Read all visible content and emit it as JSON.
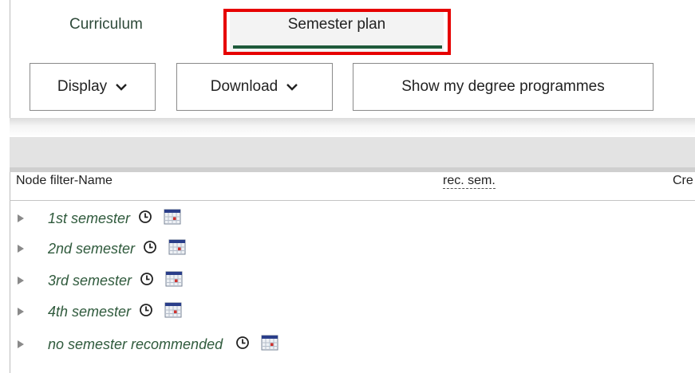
{
  "tabs": [
    {
      "label": "Curriculum"
    },
    {
      "label": "Semester plan"
    }
  ],
  "toolbar": {
    "display_label": "Display",
    "download_label": "Download",
    "show_programmes_label": "Show my degree programmes"
  },
  "table": {
    "columns": [
      "Node filter-Name",
      "rec. sem.",
      "Cre"
    ]
  },
  "rows": [
    {
      "label": "1st semester"
    },
    {
      "label": "2nd semester"
    },
    {
      "label": "3rd semester"
    },
    {
      "label": "4th semester"
    },
    {
      "label": "no semester recommended"
    }
  ],
  "colors": {
    "accent_green": "#1e5a3b",
    "link_green": "#2f5a3c",
    "highlight_red": "#e60000"
  },
  "icons": [
    "chevron-down-icon",
    "clock-icon",
    "calendar-icon",
    "expand-triangle-icon"
  ]
}
